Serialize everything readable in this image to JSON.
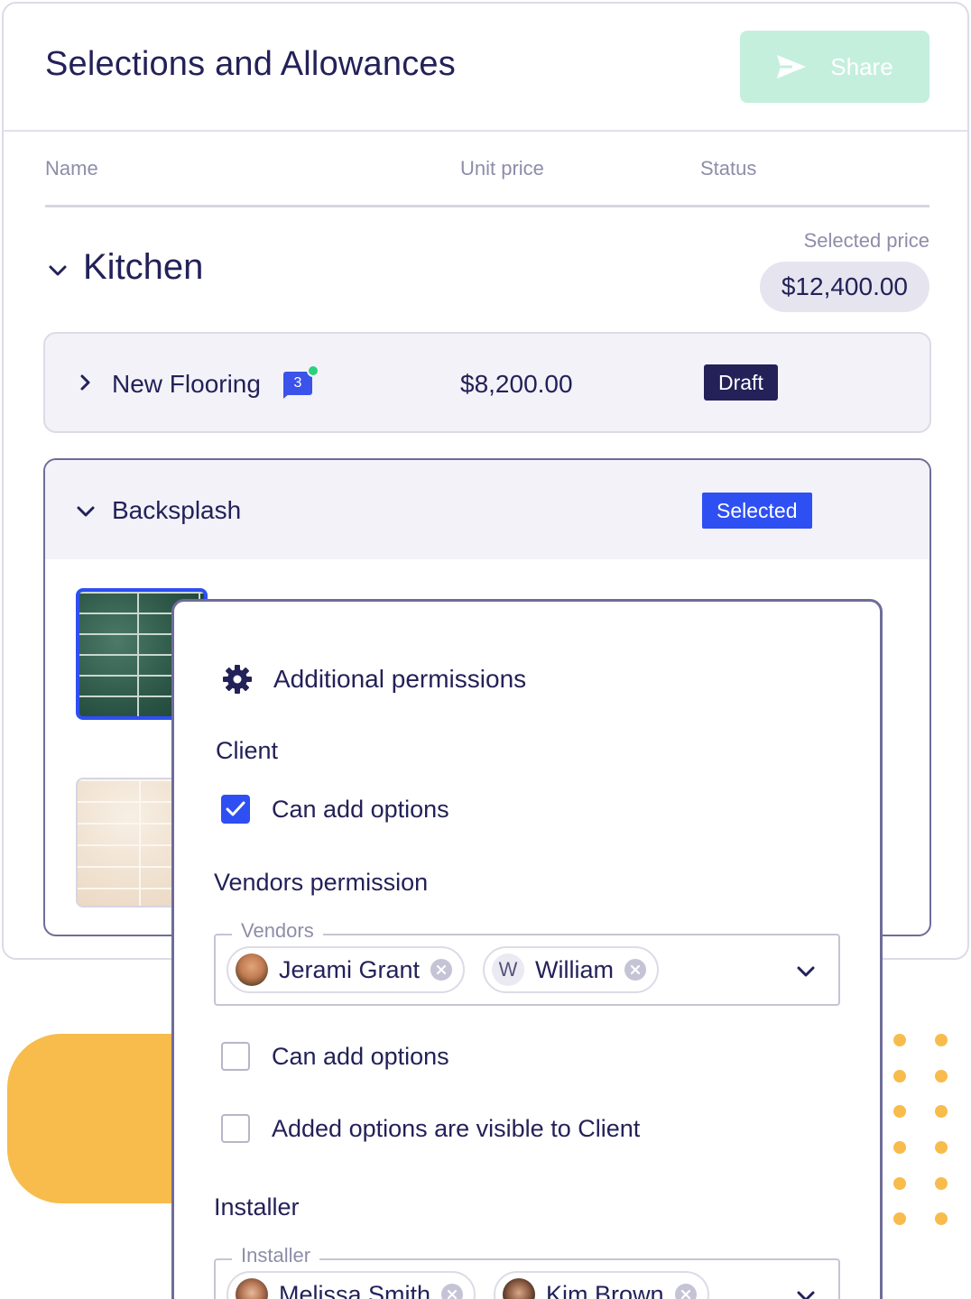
{
  "header": {
    "title": "Selections and Allowances",
    "share_label": "Share"
  },
  "table": {
    "columns": [
      "Name",
      "Unit price",
      "Status"
    ]
  },
  "group": {
    "title": "Kitchen",
    "selected_price_label": "Selected price",
    "selected_price": "$12,400.00"
  },
  "items": [
    {
      "name": "New Flooring",
      "comment_count": "3",
      "unit_price": "$8,200.00",
      "status": "Draft"
    },
    {
      "name": "Backsplash",
      "status": "Selected"
    }
  ],
  "permissions": {
    "title": "Additional permissions",
    "client": {
      "title": "Client",
      "options": [
        {
          "label": "Can add options",
          "checked": true
        }
      ]
    },
    "vendors": {
      "title": "Vendors permission",
      "field_label": "Vendors",
      "chips": [
        {
          "name": "Jerami Grant",
          "avatar": "photo"
        },
        {
          "name": "William",
          "avatar_initial": "W"
        }
      ],
      "options": [
        {
          "label": "Can add options",
          "checked": false
        },
        {
          "label": "Added options are visible to Client",
          "checked": false
        }
      ]
    },
    "installer": {
      "title": "Installer",
      "field_label": "Installer",
      "chips": [
        {
          "name": "Melissa Smith",
          "avatar": "photo"
        },
        {
          "name": "Kim Brown",
          "avatar": "photo"
        }
      ]
    }
  },
  "colors": {
    "primary_text": "#232158",
    "accent_blue": "#2e4ff2",
    "share_button": "#c4efdc",
    "decor_yellow": "#f7bc4c",
    "online_dot": "#2dd07a"
  },
  "icons": {
    "share": "send-icon",
    "settings": "gear-icon",
    "expand": "chevron-down-icon",
    "collapse": "chevron-right-icon",
    "remove": "close-circle-icon",
    "comments": "chat-bubble-icon",
    "check": "checkmark-icon"
  }
}
